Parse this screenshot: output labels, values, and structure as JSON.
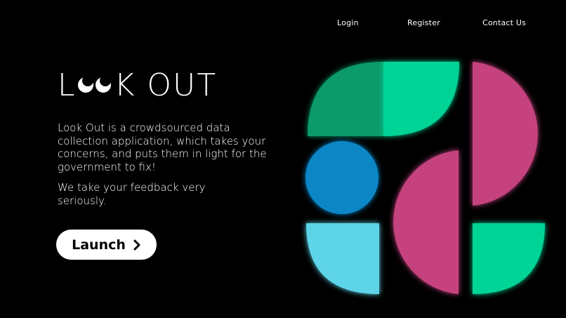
{
  "nav": {
    "login": "Login",
    "register": "Register",
    "contact": "Contact Us"
  },
  "logo": {
    "prefix": "L",
    "suffix": "K OUT"
  },
  "hero": {
    "description": "Look Out is a crowdsourced data collection application, which takes your concerns, and puts them in light for the government to fix!",
    "tagline": "We take your feedback very seriously."
  },
  "cta": {
    "label": "Launch",
    "icon": "chevron-right-icon"
  },
  "colors": {
    "background": "#000000",
    "green_dark": "#0e9a6a",
    "green_bright": "#05d396",
    "pink": "#c5427f",
    "blue": "#0b86c6",
    "light_blue": "#5dd4e8"
  }
}
